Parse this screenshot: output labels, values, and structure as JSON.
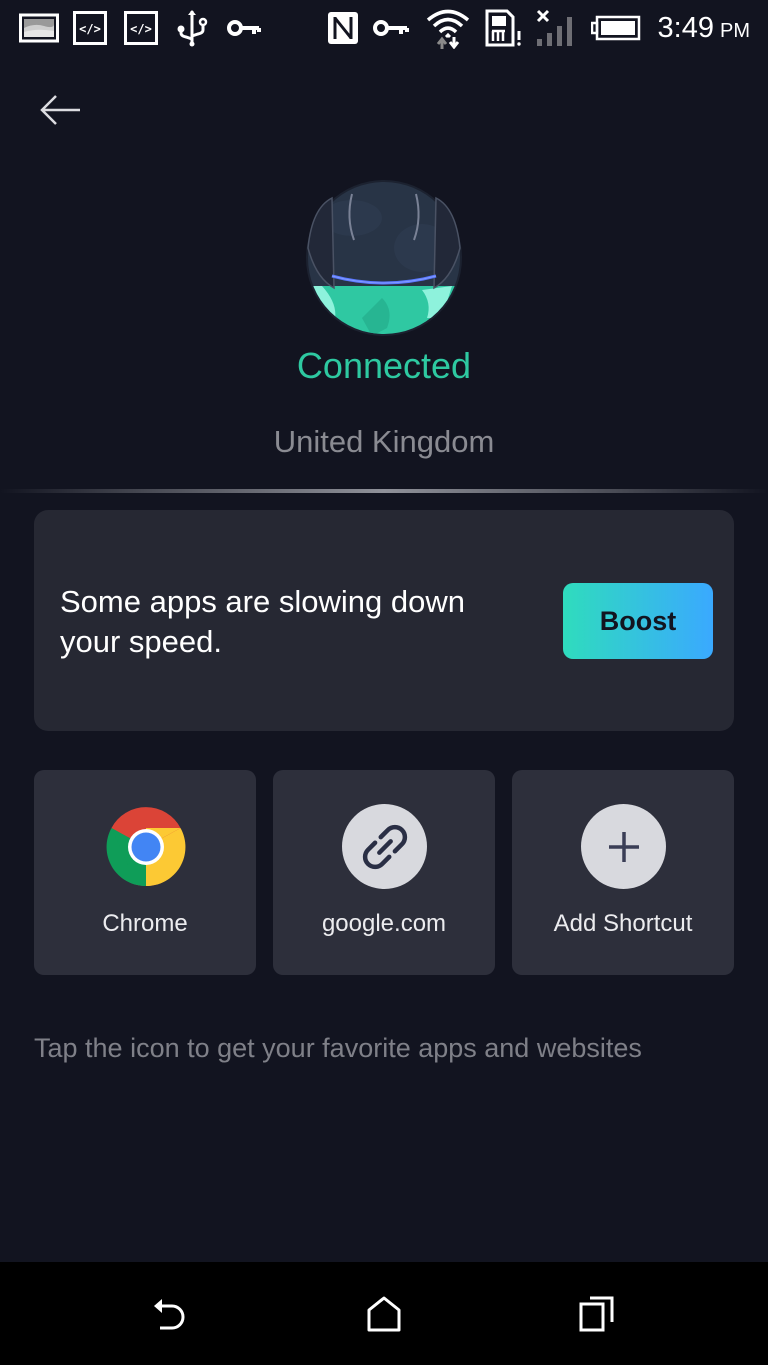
{
  "status_bar": {
    "left_icons": [
      "image-notification-icon",
      "code-notification-icon",
      "code-notification-icon",
      "usb-icon",
      "vpn-key-icon"
    ],
    "right_icons": [
      "nfc-icon",
      "vpn-key-icon",
      "wifi-icon",
      "sim-alert-icon",
      "signal-no-service-icon",
      "battery-full-icon"
    ],
    "time": "3:49",
    "ampm": "PM"
  },
  "header": {
    "back_icon": "arrow-left-icon"
  },
  "connection": {
    "status": "Connected",
    "location": "United Kingdom",
    "status_color": "#2ec9a1"
  },
  "boost": {
    "message": "Some apps are slowing down your speed.",
    "button_label": "Boost",
    "gradient": [
      "#2fdcbd",
      "#3aa9ff"
    ]
  },
  "shortcuts": [
    {
      "label": "Chrome",
      "icon": "chrome-icon"
    },
    {
      "label": "google.com",
      "icon": "link-icon"
    },
    {
      "label": "Add Shortcut",
      "icon": "plus-icon"
    }
  ],
  "hint": "Tap the icon to get your favorite apps and websites",
  "nav_bar": {
    "buttons": [
      "back-icon",
      "home-icon",
      "recents-icon"
    ]
  }
}
